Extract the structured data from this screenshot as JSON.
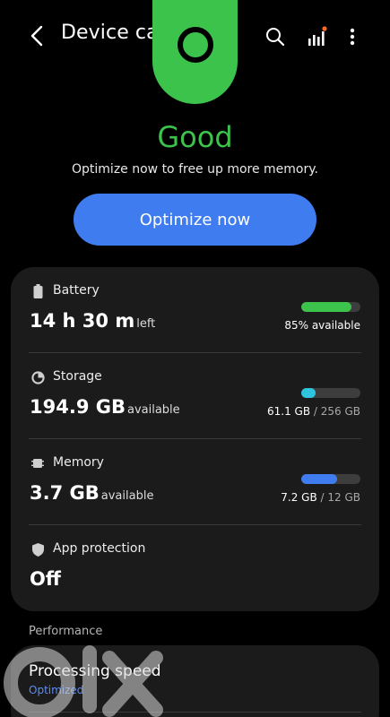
{
  "header": {
    "title": "Device care",
    "back_icon": "back-arrow-icon",
    "search_icon": "search-icon",
    "diagnostics_icon": "signal-bars-icon",
    "more_icon": "more-vert-icon"
  },
  "status": {
    "label": "Good",
    "subtitle": "Optimize now to free up more memory.",
    "color": "#3cc34b"
  },
  "optimize_button": {
    "label": "Optimize now",
    "color": "#3f7cf0"
  },
  "items": [
    {
      "label": "Battery",
      "value": "14 h 30 m",
      "suffix": "left",
      "detail": "85% available",
      "detail_extra": "",
      "level": 0.85,
      "bar_color": "#3cc34b"
    },
    {
      "label": "Storage",
      "value": "194.9 GB",
      "suffix": "available",
      "detail": "61.1 GB",
      "detail_extra": " / 256 GB",
      "level": 0.24,
      "bar_color": "#2ec4e0"
    },
    {
      "label": "Memory",
      "value": "3.7 GB",
      "suffix": "available",
      "detail": "7.2 GB",
      "detail_extra": " / 12 GB",
      "level": 0.6,
      "bar_color": "#3f7cf0"
    },
    {
      "label": "App protection",
      "value": "Off",
      "suffix": "",
      "detail": "",
      "detail_extra": "",
      "level": null,
      "bar_color": ""
    }
  ],
  "performance": {
    "section_label": "Performance",
    "title": "Processing speed",
    "status": "Optimized"
  }
}
